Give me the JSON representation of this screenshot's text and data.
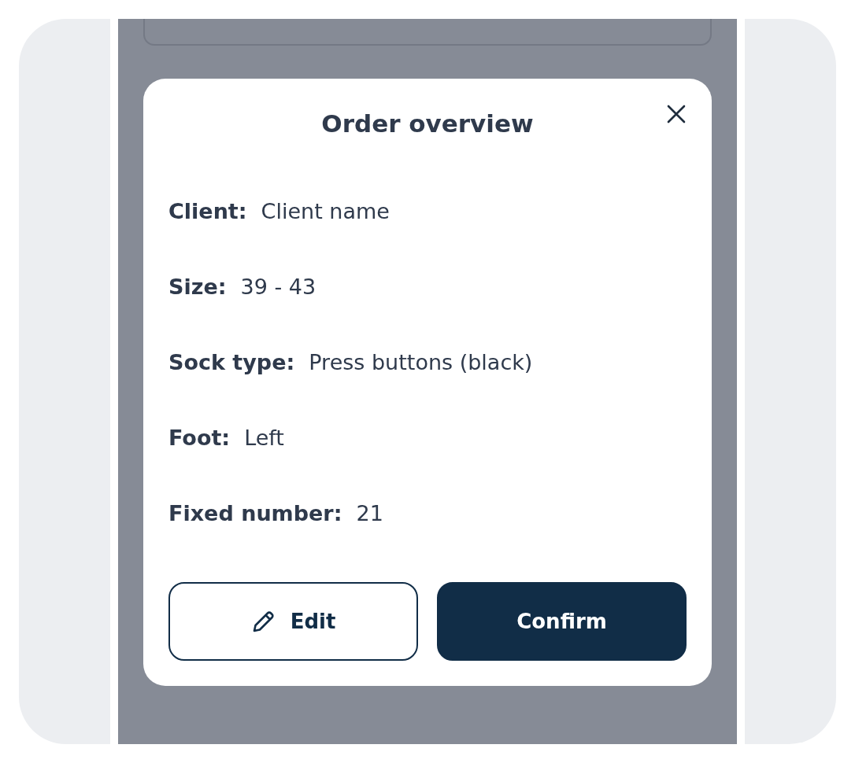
{
  "modal": {
    "title": "Order overview",
    "fields": [
      {
        "label": "Client:",
        "value": "Client name"
      },
      {
        "label": "Size:",
        "value": "39 - 43"
      },
      {
        "label": "Sock type:",
        "value": "Press buttons (black)"
      },
      {
        "label": "Foot:",
        "value": "Left"
      },
      {
        "label": "Fixed number:",
        "value": "21"
      }
    ],
    "buttons": [
      {
        "label": "Edit",
        "kind": "outline"
      },
      {
        "label": "Confirm",
        "kind": "primary"
      }
    ]
  }
}
